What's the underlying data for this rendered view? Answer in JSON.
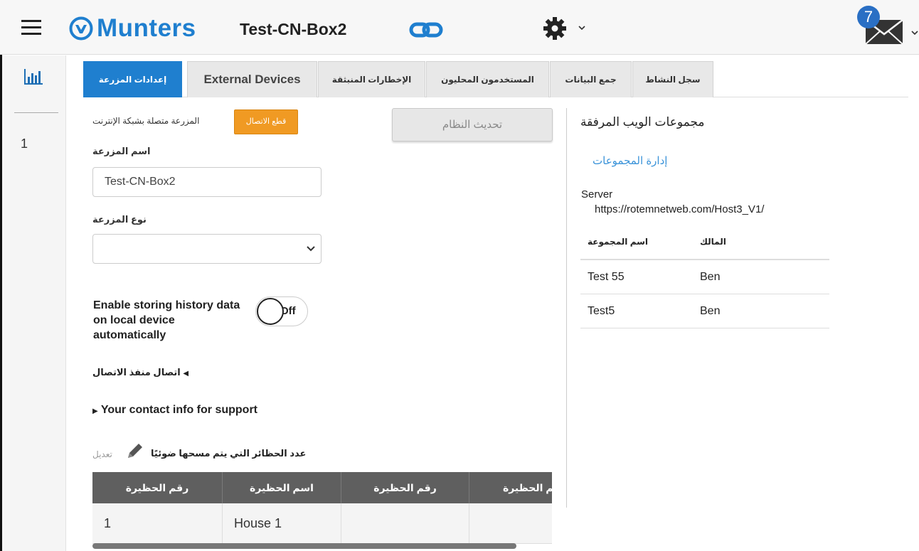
{
  "header": {
    "brand": "Munters",
    "farm_title": "Test-CN-Box2",
    "mail_badge": "7"
  },
  "rail": {
    "number": "1"
  },
  "tabs": [
    {
      "label": "إعدادات المزرعة",
      "active": true
    },
    {
      "label": "External Devices",
      "active": false
    },
    {
      "label": "الإخطارات المنبثقة",
      "active": false
    },
    {
      "label": "المستخدمون المحليون",
      "active": false
    },
    {
      "label": "جمع البيانات",
      "active": false
    },
    {
      "label": "سجل النشاط",
      "active": false
    }
  ],
  "farm": {
    "connection_status": "المزرعة متصلة بشبكة الإنترنت",
    "disconnect_label": "قطع الاتصال",
    "system_update_label": "تحديث النظام",
    "name_label": "اسم المزرعة",
    "name_value": "Test-CN-Box2",
    "type_label": "نوع المزرعة",
    "type_value": "",
    "storing_label": "Enable storing history data on local device automatically",
    "toggle_state": "Off",
    "port_section": "اتصال منفذ الاتصال",
    "contact_section": "Your contact info for support",
    "edit_label": "تعديل",
    "houses_scanned_label": "عدد الحظائر التي يتم مسحها ضوئيًا"
  },
  "houses_table": {
    "headers": [
      "رقم الحظيرة",
      "اسم الحظيرة",
      "رقم الحظيرة",
      "سم الحظيرة"
    ],
    "rows": [
      [
        "1",
        "House 1",
        "",
        ""
      ]
    ]
  },
  "web_groups": {
    "title": "مجموعات الويب المرفقة",
    "manage_link": "إدارة المجموعات",
    "server_label": "Server",
    "server_url": "https://rotemnetweb.com/Host3_V1/",
    "headers": {
      "group_name": "اسم المجموعة",
      "owner": "المالك"
    },
    "rows": [
      {
        "group_name": "Test 55",
        "owner": "Ben"
      },
      {
        "group_name": "Test5",
        "owner": "Ben"
      }
    ]
  },
  "colors": {
    "brand_blue": "#1f7fcf",
    "disconnect_orange": "#f09a23",
    "table_header": "#5f5f5f",
    "link_blue": "#3a93d9"
  }
}
